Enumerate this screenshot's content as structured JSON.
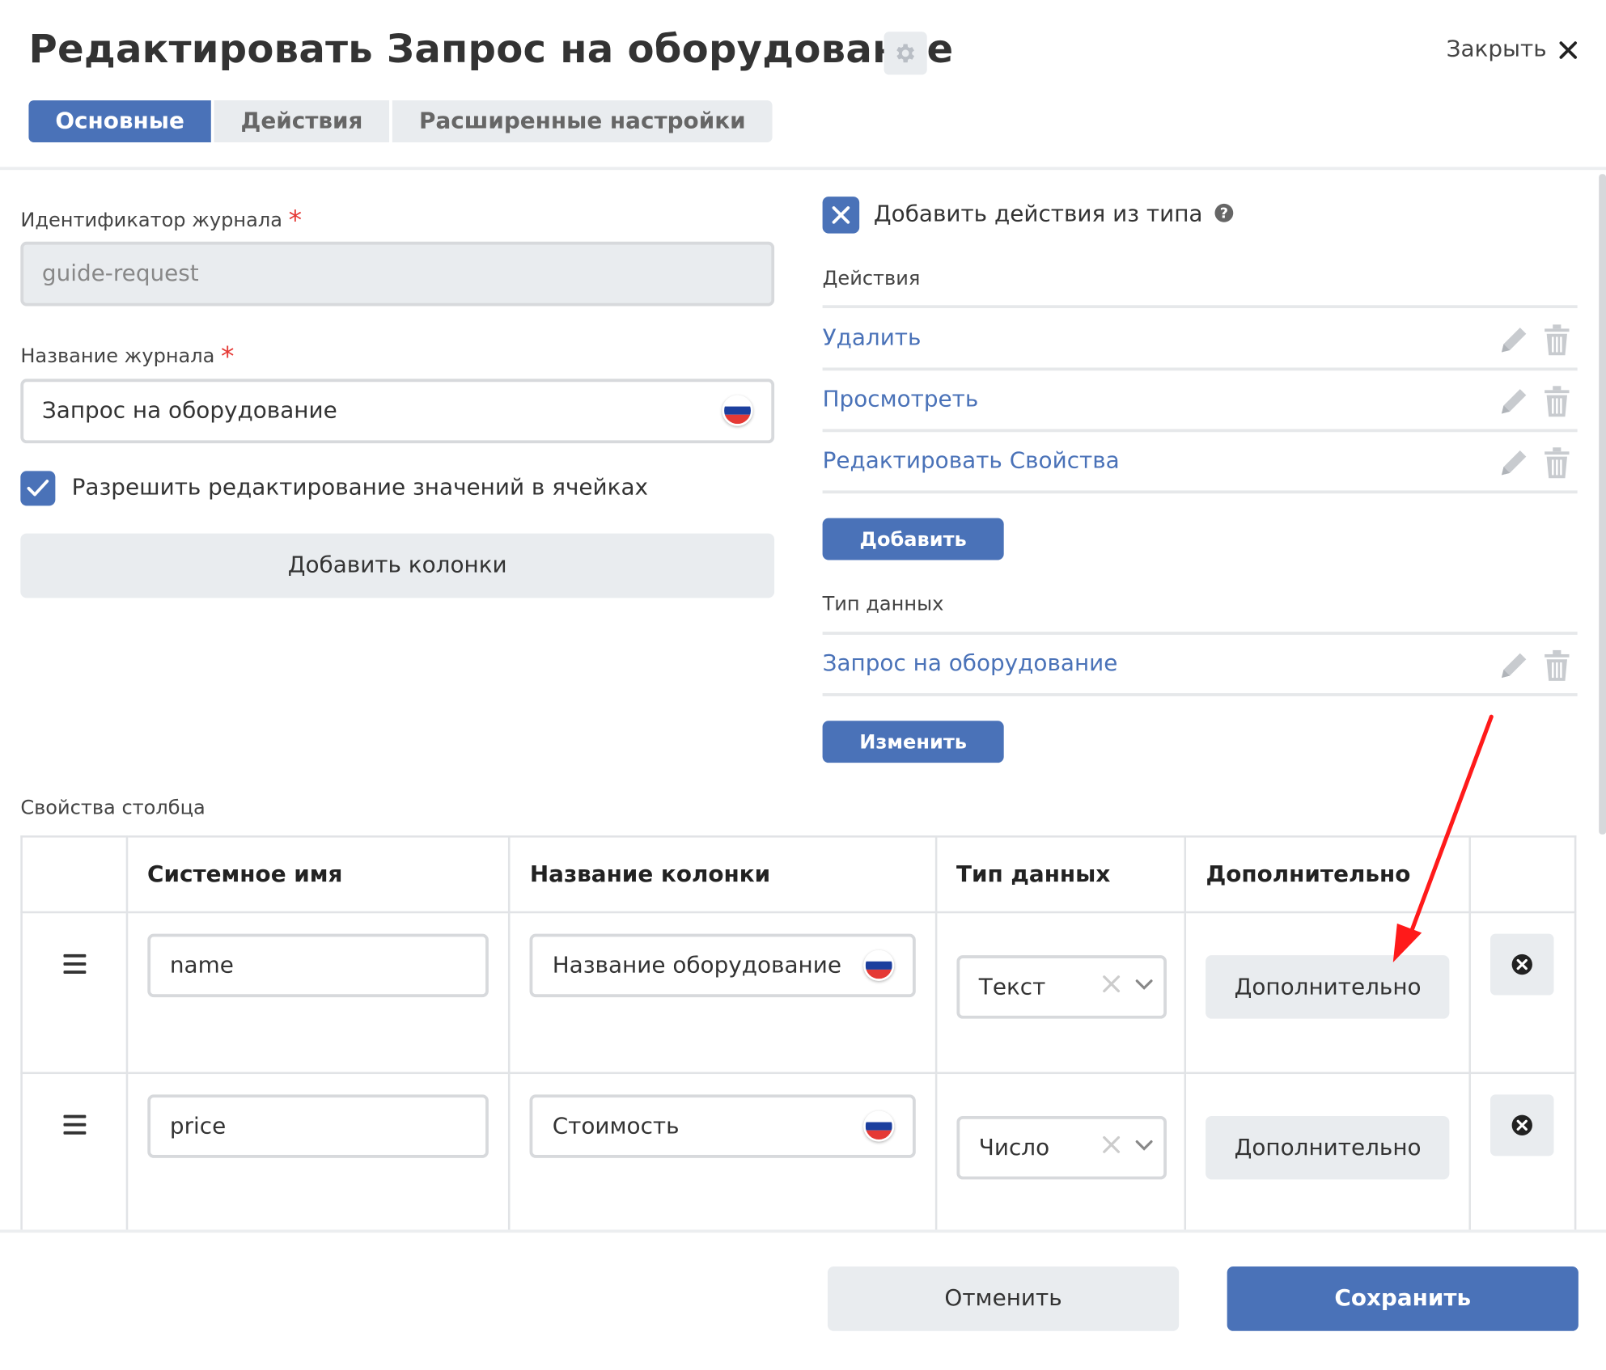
{
  "header": {
    "title": "Редактировать Запрос на оборудование",
    "close_label": "Закрыть"
  },
  "tabs": [
    {
      "label": "Основные",
      "active": true
    },
    {
      "label": "Действия",
      "active": false
    },
    {
      "label": "Расширенные настройки",
      "active": false
    }
  ],
  "left": {
    "journal_id_label": "Идентификатор журнала",
    "journal_id_value": "guide-request",
    "journal_name_label": "Название журнала",
    "journal_name_value": "Запрос на оборудование",
    "allow_edit_label": "Разрешить редактирование значений в ячейках",
    "allow_edit_checked": true,
    "add_columns_label": "Добавить колонки",
    "required_mark": "*"
  },
  "right": {
    "add_actions_label": "Добавить действия из типа",
    "add_actions_checked": true,
    "actions_section_label": "Действия",
    "actions": [
      {
        "label": "Удалить"
      },
      {
        "label": "Просмотреть"
      },
      {
        "label": "Редактировать Свойства"
      }
    ],
    "add_button_label": "Добавить",
    "data_type_section_label": "Тип данных",
    "data_type_value": "Запрос на оборудование",
    "change_button_label": "Изменить"
  },
  "columns": {
    "section_label": "Свойства столбца",
    "headers": [
      "Системное имя",
      "Название колонки",
      "Тип данных",
      "Дополнительно"
    ],
    "rows": [
      {
        "system_name": "name",
        "column_name": "Название оборудование",
        "data_type": "Текст",
        "extra_label": "Дополнительно"
      },
      {
        "system_name": "price",
        "column_name": "Стоимость",
        "data_type": "Число",
        "extra_label": "Дополнительно"
      }
    ]
  },
  "footer": {
    "cancel_label": "Отменить",
    "save_label": "Сохранить"
  },
  "colors": {
    "primary": "#4a72b8",
    "required": "#e53935",
    "annotation_arrow": "#ff1a1a",
    "button_grey": "#e9ecef"
  },
  "icons": [
    "gear-icon",
    "close-icon",
    "checkmark-icon",
    "x-checkbox-icon",
    "help-icon",
    "pencil-icon",
    "trash-icon",
    "russian-flag-icon",
    "drag-handle-icon",
    "clear-icon",
    "chevron-down-icon",
    "remove-circle-icon"
  ]
}
